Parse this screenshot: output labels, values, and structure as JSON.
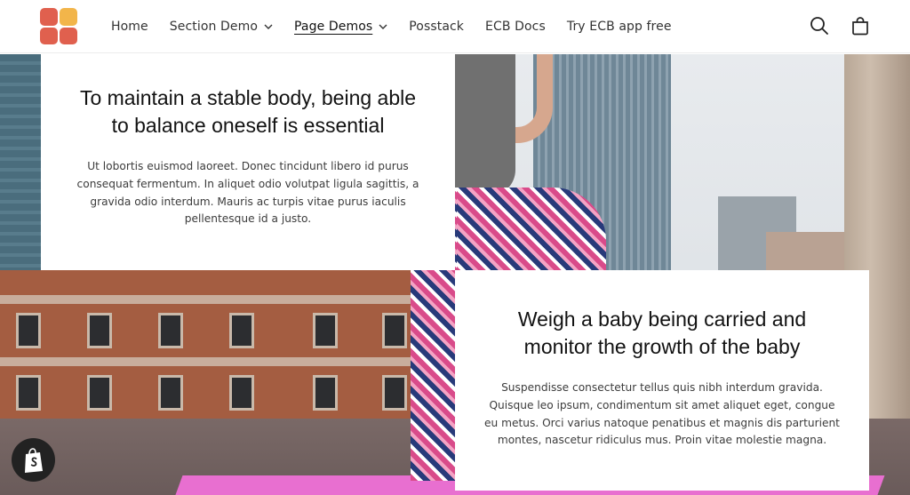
{
  "header": {
    "nav": [
      {
        "label": "Home",
        "dropdown": false,
        "active": false
      },
      {
        "label": "Section Demo",
        "dropdown": true,
        "active": false
      },
      {
        "label": "Page Demos",
        "dropdown": true,
        "active": true
      },
      {
        "label": "Posstack",
        "dropdown": false,
        "active": false
      },
      {
        "label": "ECB Docs",
        "dropdown": false,
        "active": false
      },
      {
        "label": "Try ECB app free",
        "dropdown": false,
        "active": false
      }
    ],
    "icons": [
      "search-icon",
      "cart-icon"
    ]
  },
  "cards": [
    {
      "title": "To maintain a stable body, being able to balance oneself is essential",
      "body": "Ut lobortis euismod laoreet. Donec tincidunt libero id purus consequat fermentum. In aliquet odio volutpat ligula sagittis, a gravida odio interdum. Mauris ac turpis vitae purus iaculis pellentesque id a justo."
    },
    {
      "title": "Weigh a baby being carried and monitor the growth of the baby",
      "body": "Suspendisse consectetur tellus quis nibh interdum gravida. Quisque leo ipsum, condimentum sit amet aliquet eget, congue eu metus. Orci varius natoque penatibus et magnis dis parturient montes, nascetur ridiculus mus. Proin vitae molestie magna."
    }
  ],
  "colors": {
    "logo_red": "#e0604e",
    "logo_yellow": "#f2b54a",
    "mat": "#e86fd0"
  }
}
